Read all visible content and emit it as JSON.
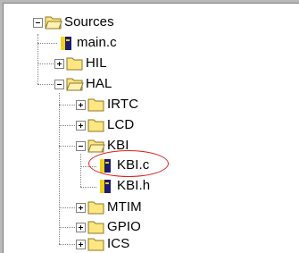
{
  "tree": {
    "nodes": {
      "sources": {
        "label": "Sources",
        "state": "expanded",
        "kind": "folder"
      },
      "main_c": {
        "label": "main.c",
        "kind": "file"
      },
      "hil": {
        "label": "HIL",
        "state": "collapsed",
        "kind": "folder"
      },
      "hal": {
        "label": "HAL",
        "state": "expanded",
        "kind": "folder"
      },
      "irtc": {
        "label": "IRTC",
        "state": "collapsed",
        "kind": "folder"
      },
      "lcd": {
        "label": "LCD",
        "state": "collapsed",
        "kind": "folder"
      },
      "kbi": {
        "label": "KBI",
        "state": "expanded",
        "kind": "folder"
      },
      "kbi_c": {
        "label": "KBI.c",
        "kind": "file",
        "highlighted": true
      },
      "kbi_h": {
        "label": "KBI.h",
        "kind": "file"
      },
      "mtim": {
        "label": "MTIM",
        "state": "collapsed",
        "kind": "folder"
      },
      "gpio": {
        "label": "GPIO",
        "state": "collapsed",
        "kind": "folder"
      },
      "ics": {
        "label": "ICS",
        "state": "collapsed",
        "kind": "folder"
      }
    }
  },
  "colors": {
    "folder_fill": "#ffe680",
    "folder_edge": "#8a7a2a",
    "file_yellow": "#f2d21c",
    "file_navy": "#1c1c70",
    "tree_lines": "#808080",
    "highlight_ring": "#e02020",
    "frame": "#b8b8b8"
  },
  "icons": {
    "folder_open": "folder-open-icon",
    "folder_closed": "folder-icon",
    "source_file": "source-file-icon"
  }
}
